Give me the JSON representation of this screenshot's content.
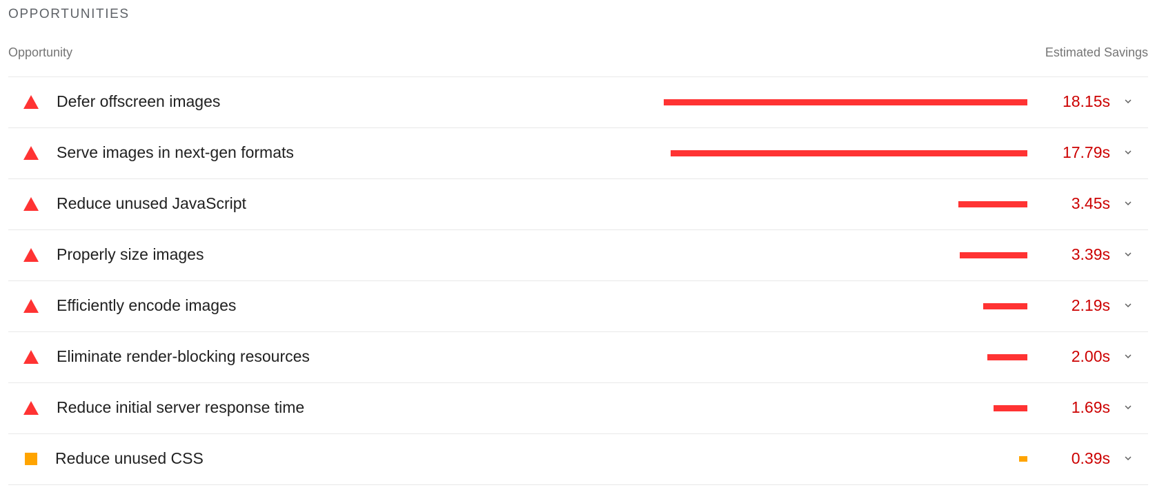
{
  "section": {
    "title": "OPPORTUNITIES"
  },
  "headers": {
    "opportunity": "Opportunity",
    "savings": "Estimated Savings"
  },
  "colors": {
    "fail": "#ff3333",
    "average": "#ffa400",
    "value_text": "#cc0000",
    "divider": "#e8e8e8"
  },
  "max_savings_s": 18.15,
  "opportunities": [
    {
      "title": "Defer offscreen images",
      "savings_label": "18.15s",
      "savings_s": 18.15,
      "status": "fail",
      "icon": "fail-triangle-icon"
    },
    {
      "title": "Serve images in next-gen formats",
      "savings_label": "17.79s",
      "savings_s": 17.79,
      "status": "fail",
      "icon": "fail-triangle-icon"
    },
    {
      "title": "Reduce unused JavaScript",
      "savings_label": "3.45s",
      "savings_s": 3.45,
      "status": "fail",
      "icon": "fail-triangle-icon"
    },
    {
      "title": "Properly size images",
      "savings_label": "3.39s",
      "savings_s": 3.39,
      "status": "fail",
      "icon": "fail-triangle-icon"
    },
    {
      "title": "Efficiently encode images",
      "savings_label": "2.19s",
      "savings_s": 2.19,
      "status": "fail",
      "icon": "fail-triangle-icon"
    },
    {
      "title": "Eliminate render-blocking resources",
      "savings_label": "2.00s",
      "savings_s": 2.0,
      "status": "fail",
      "icon": "fail-triangle-icon"
    },
    {
      "title": "Reduce initial server response time",
      "savings_label": "1.69s",
      "savings_s": 1.69,
      "status": "fail",
      "icon": "fail-triangle-icon"
    },
    {
      "title": "Reduce unused CSS",
      "savings_label": "0.39s",
      "savings_s": 0.39,
      "status": "average",
      "icon": "average-square-icon"
    }
  ]
}
